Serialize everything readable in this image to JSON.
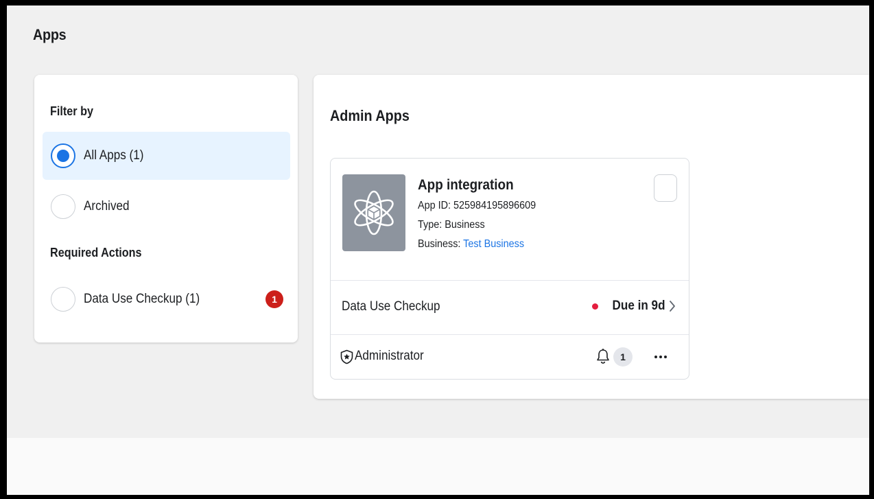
{
  "page": {
    "title": "Apps"
  },
  "filter": {
    "heading": "Filter by",
    "items": [
      {
        "label": "All Apps (1)",
        "selected": true
      },
      {
        "label": "Archived",
        "selected": false
      }
    ],
    "required_heading": "Required Actions",
    "required_items": [
      {
        "label": "Data Use Checkup (1)",
        "badge": "1"
      }
    ]
  },
  "admin": {
    "title": "Admin Apps",
    "app": {
      "icon": "atom-icon",
      "name": "App integration",
      "id_line": "App ID: 525984195896609",
      "type_line": "Type: Business",
      "business_prefix": "Business: ",
      "business_name": "Test Business",
      "checkup_label": "Data Use Checkup",
      "due_text": "Due in 9d",
      "role": "Administrator",
      "notifications": "1"
    }
  },
  "colors": {
    "accent": "#1b74e4",
    "badge_red": "#cc1f1a",
    "status_red": "#e41e3f",
    "selected_bg": "#e7f3ff"
  }
}
